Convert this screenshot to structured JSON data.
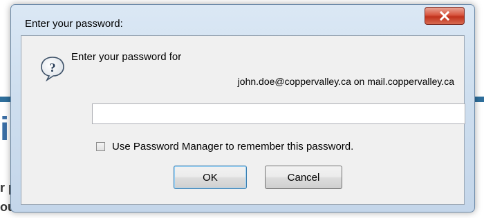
{
  "background": {
    "fragment_big": "i",
    "fragment_line1": "r p",
    "fragment_line2": "our man."
  },
  "dialog": {
    "title": "Enter your password:",
    "close_glyph": "X",
    "prompt": "Enter your password for",
    "account": "john.doe@coppervalley.ca on mail.coppervalley.ca",
    "password_value": "",
    "remember_label": "Use Password Manager to remember this password.",
    "remember_checked": false,
    "ok_label": "OK",
    "cancel_label": "Cancel"
  },
  "colors": {
    "frame": "#cfdfef",
    "close": "#c0311c",
    "ok_border": "#3c7fb1"
  },
  "icons": {
    "dialog_icon": "question-speech-bubble-icon"
  }
}
